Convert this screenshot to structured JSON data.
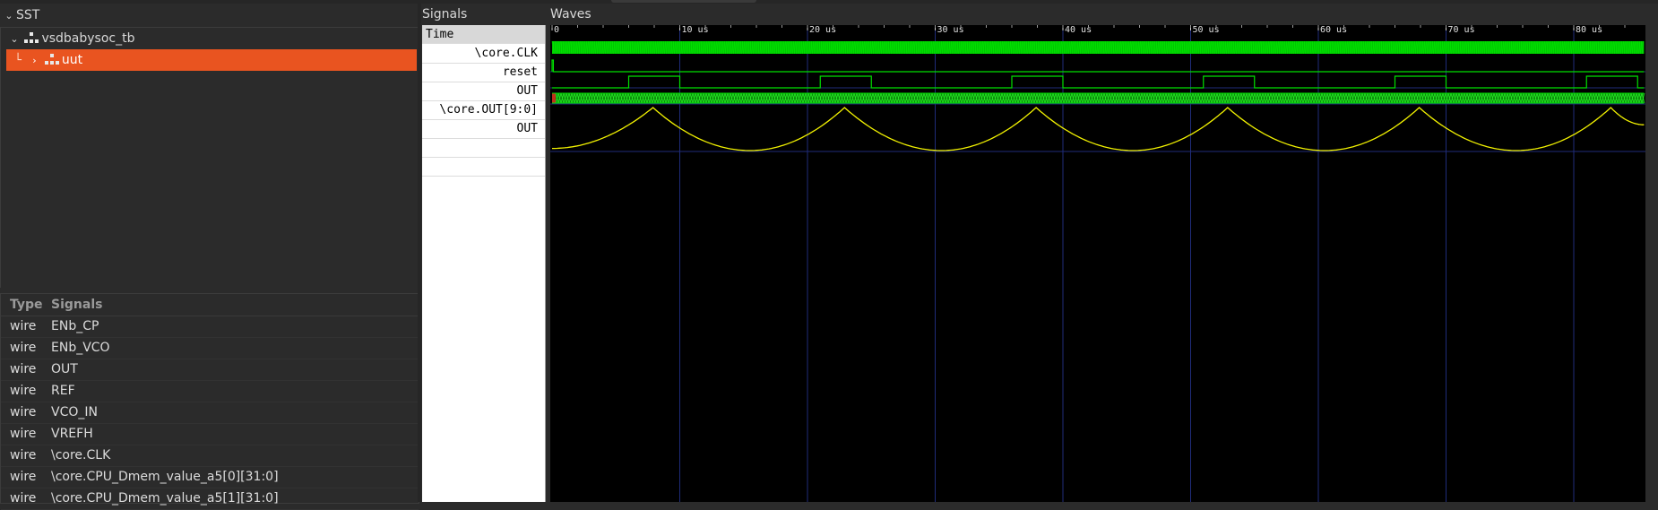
{
  "sst": {
    "title": "SST",
    "tree": [
      {
        "label": "vsdbabysoc_tb",
        "expanded": true
      },
      {
        "label": "uut",
        "selected": true,
        "expanded": false
      }
    ]
  },
  "signal_list": {
    "headers": {
      "type": "Type",
      "signals": "Signals"
    },
    "rows": [
      {
        "type": "wire",
        "name": "ENb_CP"
      },
      {
        "type": "wire",
        "name": "ENb_VCO"
      },
      {
        "type": "wire",
        "name": "OUT"
      },
      {
        "type": "wire",
        "name": "REF"
      },
      {
        "type": "wire",
        "name": "VCO_IN"
      },
      {
        "type": "wire",
        "name": "VREFH"
      },
      {
        "type": "wire",
        "name": "\\core.CLK"
      },
      {
        "type": "wire",
        "name": "\\core.CPU_Dmem_value_a5[0][31:0]"
      },
      {
        "type": "wire",
        "name": "\\core.CPU_Dmem_value_a5[1][31:0]"
      }
    ]
  },
  "signals_pane": {
    "title": "Signals",
    "time_label": "Time",
    "names": [
      "\\core.CLK",
      "reset",
      "OUT",
      "\\core.OUT[9:0]",
      "OUT"
    ]
  },
  "waves_pane": {
    "title": "Waves",
    "time_ticks": [
      "0",
      "10 us",
      "20 us",
      "30 us",
      "40 us",
      "50 us",
      "60 us",
      "70 us",
      "80 us"
    ],
    "colors": {
      "digital": "#00e000",
      "bus_fill": "#0a8a0a",
      "analog": "#f2f200",
      "grid": "#1f2c7a",
      "background": "#000000",
      "selection": "#e95420"
    }
  },
  "chart_data": {
    "type": "line",
    "x_unit": "us",
    "xlim": [
      0,
      85.5
    ],
    "series": [
      {
        "name": "\\core.CLK",
        "kind": "clock",
        "period_us": 0.3
      },
      {
        "name": "reset",
        "kind": "digital",
        "points": [
          [
            0,
            1
          ],
          [
            0.1,
            0
          ],
          [
            85.5,
            0
          ]
        ]
      },
      {
        "name": "OUT",
        "kind": "digital",
        "high_intervals": [
          [
            6,
            10
          ],
          [
            21,
            25
          ],
          [
            36,
            40
          ],
          [
            51,
            55
          ],
          [
            66,
            70
          ],
          [
            81,
            85
          ]
        ]
      },
      {
        "name": "\\core.OUT[9:0]",
        "kind": "bus"
      },
      {
        "name": "OUT",
        "kind": "analog",
        "peaks_us": [
          7.9,
          22.9,
          37.9,
          52.9,
          67.9,
          82.9
        ],
        "troughs_us": [
          15.5,
          30.5,
          45.5,
          60.5,
          75.5
        ]
      }
    ]
  }
}
